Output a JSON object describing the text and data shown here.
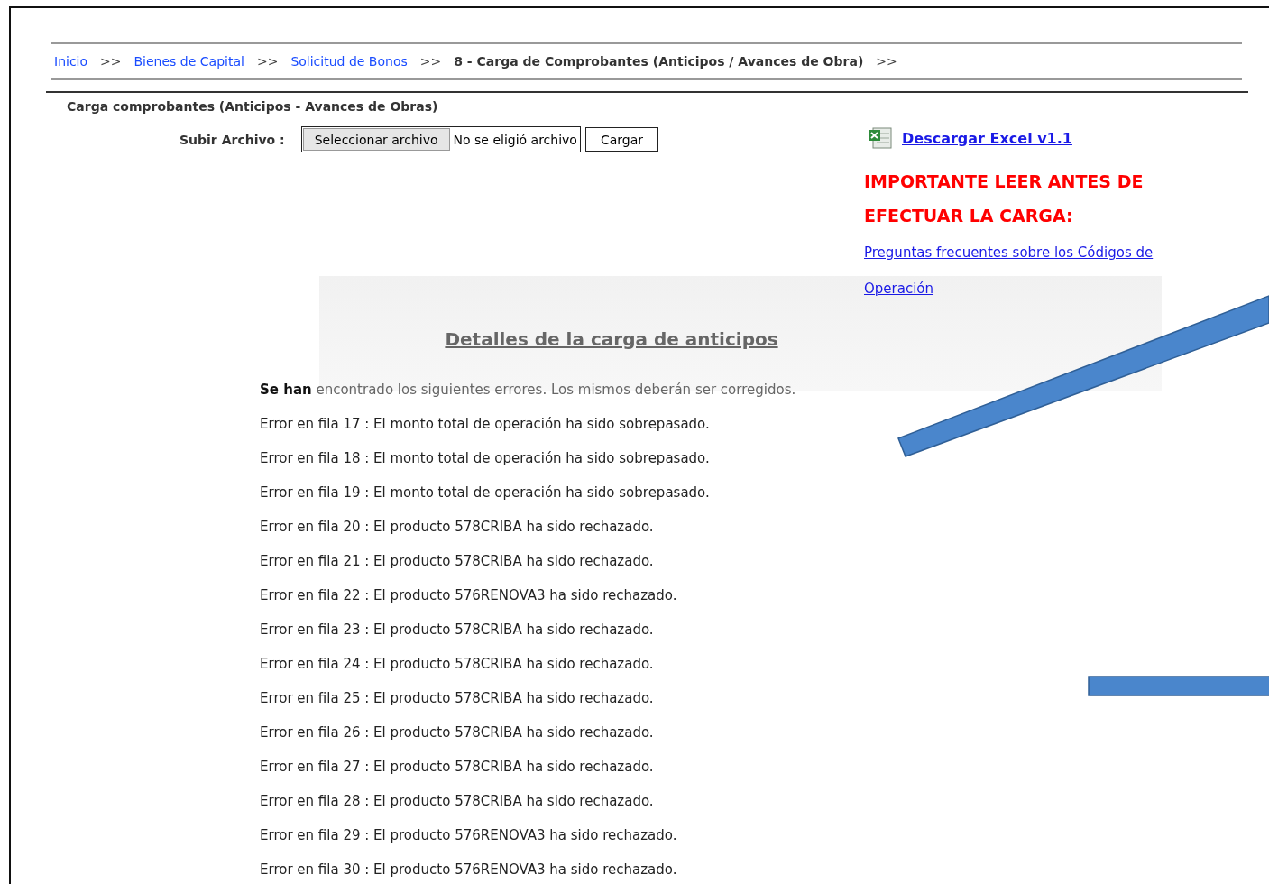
{
  "breadcrumb": [
    {
      "label": "Inicio",
      "kind": "link",
      "separator": ">>"
    },
    {
      "label": "Bienes de Capital",
      "kind": "link",
      "separator": ">>"
    },
    {
      "label": "Solicitud de Bonos",
      "kind": "link",
      "separator": ">>"
    },
    {
      "label": "8 - Carga de Comprobantes (Anticipos / Avances de Obra)",
      "kind": "current",
      "separator": ">>"
    }
  ],
  "form": {
    "title": "Carga comprobantes (Anticipos - Avances de Obras)",
    "upload_label": "Subir Archivo :",
    "file_button": "Seleccionar archivo",
    "file_status": "No se eligió archivo",
    "submit": "Cargar"
  },
  "side": {
    "download_link": "Descargar Excel v1.1",
    "warning": "IMPORTANTE LEER ANTES DE EFECTUAR LA CARGA:",
    "faq_link": "Preguntas frecuentes sobre los Códigos de Operación"
  },
  "details": {
    "heading": "Detalles de la carga de anticipos",
    "intro": "**Se han** encontrado los siguientes errores. Los mismos deberán ser corregidos.",
    "errors": [
      "Error en fila 17 : El monto total de operación ha sido sobrepasado.",
      "Error en fila 18 : El monto total de operación ha sido sobrepasado.",
      "Error en fila 19 : El monto total de operación ha sido sobrepasado.",
      "Error en fila 20 : El producto 578CRIBA ha sido rechazado.",
      "Error en fila 21 : El producto 578CRIBA ha sido rechazado.",
      "Error en fila 22 : El producto 576RENOVA3 ha sido rechazado.",
      "Error en fila 23 : El producto 578CRIBA ha sido rechazado.",
      "Error en fila 24 : El producto 578CRIBA ha sido rechazado.",
      "Error en fila 25 : El producto 578CRIBA ha sido rechazado.",
      "Error en fila 26 : El producto 578CRIBA ha sido rechazado.",
      "Error en fila 27 : El producto 578CRIBA ha sido rechazado.",
      "Error en fila 28 : El producto 578CRIBA ha sido rechazado.",
      "Error en fila 29 : El producto 576RENOVA3 ha sido rechazado.",
      "Error en fila 30 : El producto 576RENOVA3 ha sido rechazado."
    ]
  }
}
